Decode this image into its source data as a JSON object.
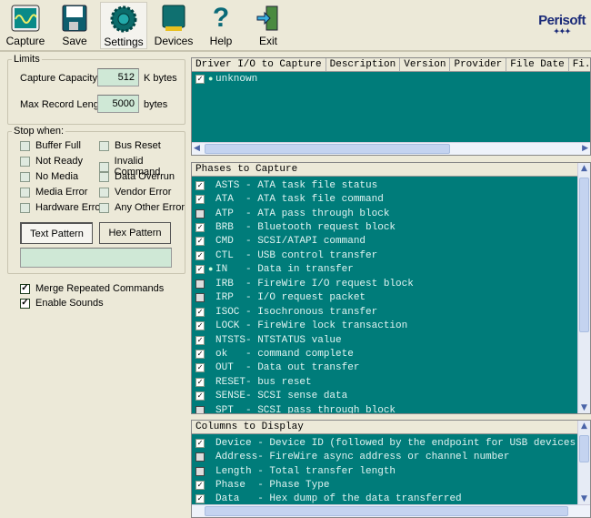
{
  "toolbar": {
    "buttons": [
      {
        "label": "Capture",
        "icon": "oscilloscope-icon"
      },
      {
        "label": "Save",
        "icon": "floppy-disk-icon"
      },
      {
        "label": "Settings",
        "icon": "settings-dial-icon"
      },
      {
        "label": "Devices",
        "icon": "device-chip-icon"
      },
      {
        "label": "Help",
        "icon": "question-mark-icon"
      },
      {
        "label": "Exit",
        "icon": "exit-door-icon"
      }
    ],
    "active": "Settings",
    "logo": "Perisoft"
  },
  "limits": {
    "title": "Limits",
    "capacity_label": "Capture Capacity:",
    "capacity_value": "512",
    "capacity_unit": "K bytes",
    "maxrec_label": "Max Record Length",
    "maxrec_value": "5000",
    "maxrec_unit": "bytes"
  },
  "stop": {
    "title": "Stop when:",
    "items": [
      {
        "label": "Buffer Full",
        "checked": false
      },
      {
        "label": "Bus Reset",
        "checked": false
      },
      {
        "label": "Not Ready",
        "checked": false
      },
      {
        "label": "Invalid Command",
        "checked": false
      },
      {
        "label": "No Media",
        "checked": false
      },
      {
        "label": "Data Overrun",
        "checked": false
      },
      {
        "label": "Media Error",
        "checked": false
      },
      {
        "label": "Vendor Error",
        "checked": false
      },
      {
        "label": "Hardware Error",
        "checked": false
      },
      {
        "label": "Any Other Error",
        "checked": false
      }
    ],
    "text_pattern": "Text Pattern",
    "hex_pattern": "Hex Pattern",
    "pattern_value": ""
  },
  "options": [
    {
      "label": "Merge Repeated Commands",
      "checked": true
    },
    {
      "label": "Enable Sounds",
      "checked": true
    }
  ],
  "drivers": {
    "columns": [
      "Driver I/O to Capture",
      "Description",
      "Version",
      "Provider",
      "File Date",
      "Fi.."
    ],
    "rows": [
      {
        "name": "unknown",
        "checked": true
      }
    ]
  },
  "phases": {
    "title": "Phases to Capture",
    "items": [
      {
        "text": "ASTS - ATA task file status",
        "checked": true
      },
      {
        "text": "ATA  - ATA task file command",
        "checked": true
      },
      {
        "text": "ATP  - ATA pass through block",
        "checked": false
      },
      {
        "text": "BRB  - Bluetooth request block",
        "checked": true
      },
      {
        "text": "CMD  - SCSI/ATAPI command",
        "checked": true
      },
      {
        "text": "CTL  - USB control transfer",
        "checked": true
      },
      {
        "text": "IN   - Data in transfer",
        "checked": true,
        "marked": true
      },
      {
        "text": "IRB  - FireWire I/O request block",
        "checked": false
      },
      {
        "text": "IRP  - I/O request packet",
        "checked": false
      },
      {
        "text": "ISOC - Isochronous transfer",
        "checked": true
      },
      {
        "text": "LOCK - FireWire lock transaction",
        "checked": true
      },
      {
        "text": "NTSTS- NTSTATUS value",
        "checked": true
      },
      {
        "text": "ok   - command complete",
        "checked": true
      },
      {
        "text": "OUT  - Data out transfer",
        "checked": true
      },
      {
        "text": "RESET- bus reset",
        "checked": true
      },
      {
        "text": "SENSE- SCSI sense data",
        "checked": true
      },
      {
        "text": "SPT  - SCSI pass through block",
        "checked": false
      }
    ]
  },
  "columns": {
    "title": "Columns to Display",
    "items": [
      {
        "text": "Device - Device ID (followed by the endpoint for USB devices)",
        "checked": true
      },
      {
        "text": "Address- FireWire async address or channel number",
        "checked": false
      },
      {
        "text": "Length - Total transfer length",
        "checked": false
      },
      {
        "text": "Phase  - Phase Type",
        "checked": true
      },
      {
        "text": "Data   - Hex dump of the data transferred",
        "checked": true
      }
    ]
  },
  "colors": {
    "list_bg": "#007c7a",
    "field_bg": "#cfe8d6",
    "logo": "#1a2a78"
  }
}
